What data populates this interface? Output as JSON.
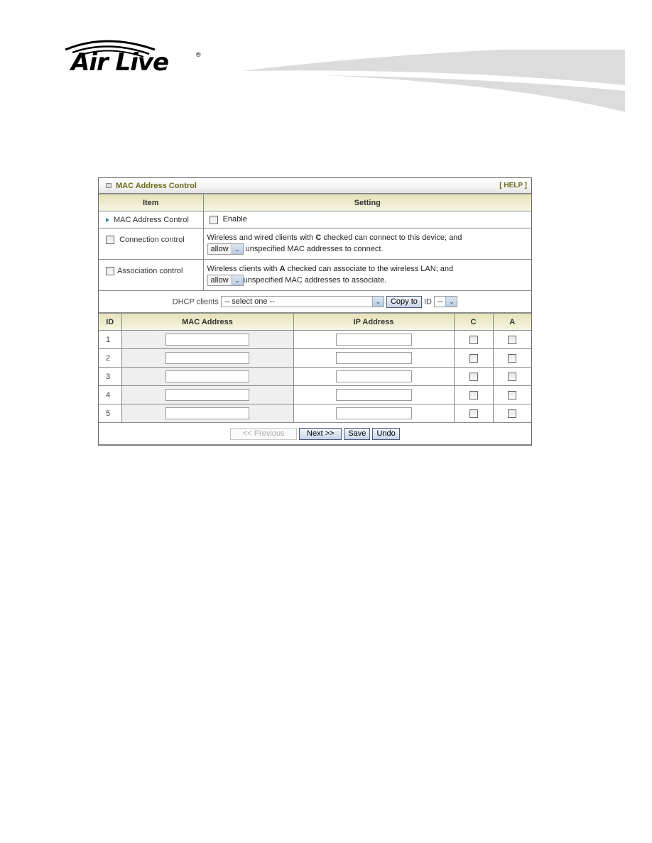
{
  "header": {
    "brand": "Air Live",
    "registered_mark": "®"
  },
  "panel": {
    "title": "MAC Address Control",
    "help_link": "[ HELP ]",
    "columns": {
      "item": "Item",
      "setting": "Setting"
    },
    "rows": {
      "mac_control": {
        "label": "MAC Address Control",
        "checkbox_label": "Enable",
        "checked": false
      },
      "connection_control": {
        "label": "Connection control",
        "checked": false,
        "text_pre": "Wireless and wired clients with ",
        "key_letter": "C",
        "text_post": " checked can connect to this device; and",
        "select_value": "allow",
        "text_line2": "unspecified MAC addresses to connect."
      },
      "association_control": {
        "label": "Association control",
        "checked": false,
        "text_pre": "Wireless clients with ",
        "key_letter": "A",
        "text_post": " checked can associate to the wireless LAN; and",
        "select_value": "allow",
        "text_line2": "unspecified MAC addresses to associate."
      }
    },
    "dhcp": {
      "label": "DHCP clients",
      "select_value": "-- select one --",
      "copy_button": "Copy to",
      "id_label": "ID",
      "id_select_value": "--"
    },
    "table": {
      "headers": {
        "id": "ID",
        "mac": "MAC Address",
        "ip": "IP Address",
        "c": "C",
        "a": "A"
      },
      "rows": [
        {
          "id": "1",
          "mac": "",
          "ip": "",
          "c": false,
          "a": false
        },
        {
          "id": "2",
          "mac": "",
          "ip": "",
          "c": false,
          "a": false
        },
        {
          "id": "3",
          "mac": "",
          "ip": "",
          "c": false,
          "a": false
        },
        {
          "id": "4",
          "mac": "",
          "ip": "",
          "c": false,
          "a": false
        },
        {
          "id": "5",
          "mac": "",
          "ip": "",
          "c": false,
          "a": false
        }
      ]
    },
    "buttons": {
      "previous": "<< Previous",
      "next": "Next >>",
      "save": "Save",
      "undo": "Undo"
    }
  }
}
